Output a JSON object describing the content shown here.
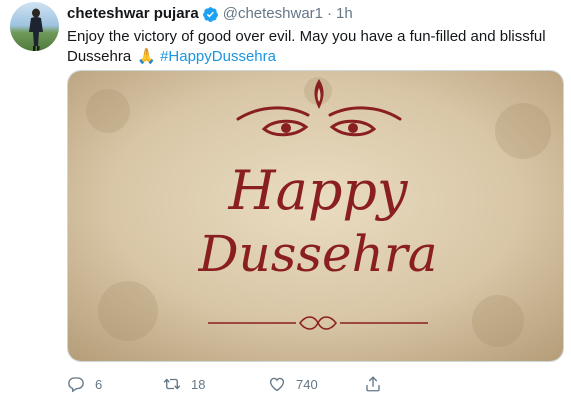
{
  "tweet": {
    "author": {
      "display_name": "cheteshwar pujara",
      "handle": "@cheteshwar1",
      "separator": "·",
      "time": "1h",
      "verified": true
    },
    "text": {
      "main": "Enjoy the victory of good over evil. May you have a fun-filled and blissful Dussehra",
      "emoji": "🙏",
      "hashtag": "#HappyDussehra"
    },
    "media": {
      "line1": "Happy",
      "line2": "Dussehra",
      "background_color": "#d9c8ab",
      "ink_color": "#8a1f22"
    },
    "actions": {
      "replies": "6",
      "retweets": "18",
      "likes": "740"
    }
  },
  "icons": {
    "verified": "verified-badge-icon",
    "reply": "reply-icon",
    "retweet": "retweet-icon",
    "like": "heart-icon",
    "share": "share-icon"
  },
  "colors": {
    "text": "#14171a",
    "muted": "#657786",
    "link": "#1b95e0"
  }
}
